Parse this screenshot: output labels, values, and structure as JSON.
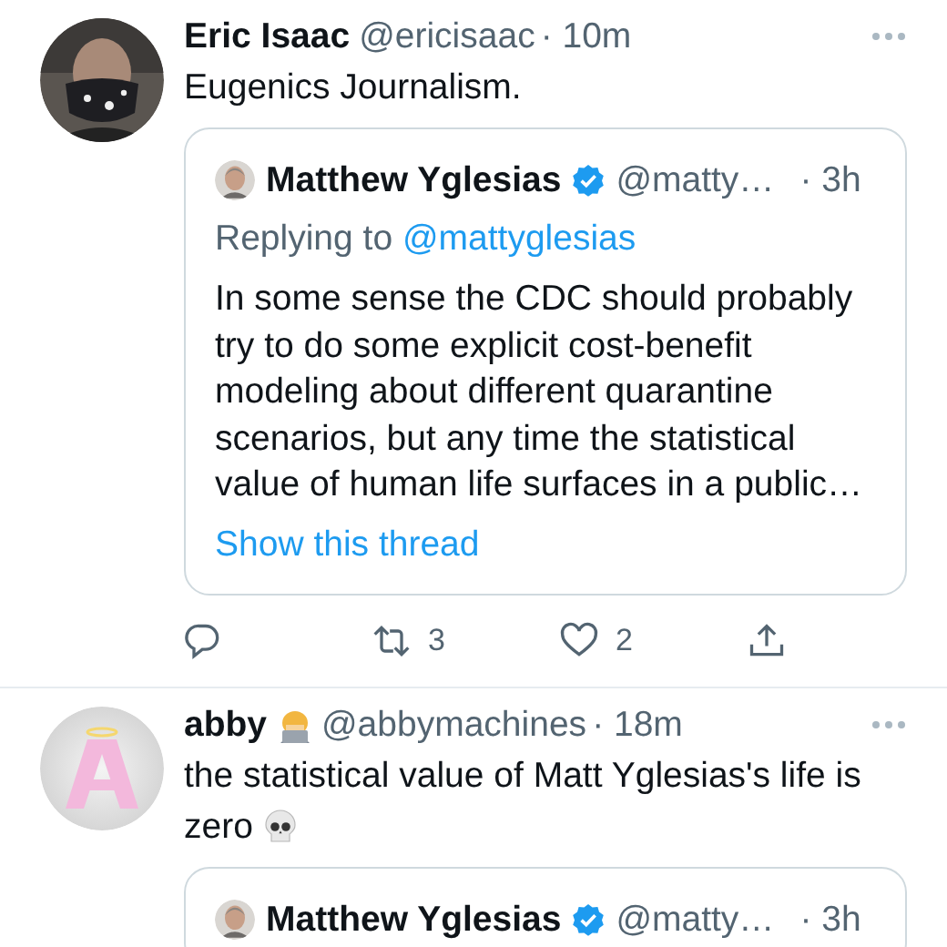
{
  "tweets": [
    {
      "author": "Eric Isaac",
      "handle": "@ericisaac",
      "time": "· 10m",
      "text": "Eugenics Journalism.",
      "quote": {
        "author": "Matthew Yglesias",
        "verified": true,
        "handle": "@matty…",
        "time": "· 3h",
        "reply_prefix": "Replying to",
        "reply_to": "@mattyglesias",
        "text": "In some sense the CDC should probably try to do some explicit cost-benefit modeling about different quarantine scenarios, but any time the statistical value of human life surfaces in a public…",
        "show_thread": "Show this thread"
      },
      "actions": [
        {
          "kind": "reply"
        },
        {
          "kind": "retweet",
          "count": "3"
        },
        {
          "kind": "like",
          "count": "2"
        },
        {
          "kind": "share"
        }
      ]
    },
    {
      "author": "abby",
      "name_emoji": true,
      "handle": "@abbymachines",
      "time": "· 18m",
      "text": "the statistical value of Matt Yglesias's life is zero",
      "text_emoji": true,
      "quote": {
        "author": "Matthew Yglesias",
        "verified": true,
        "handle": "@matty…",
        "time": "· 3h"
      }
    }
  ]
}
